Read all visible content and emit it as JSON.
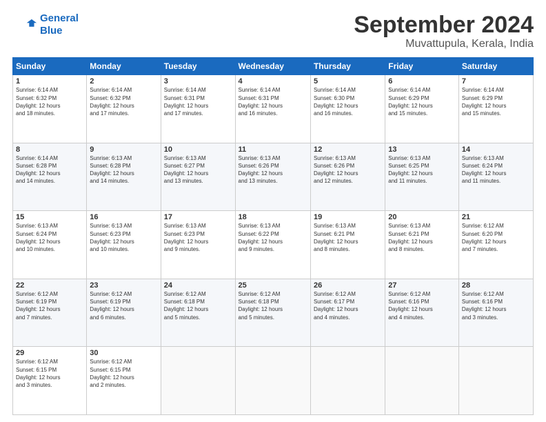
{
  "header": {
    "logo_line1": "General",
    "logo_line2": "Blue",
    "month": "September 2024",
    "location": "Muvattupula, Kerala, India"
  },
  "columns": [
    "Sunday",
    "Monday",
    "Tuesday",
    "Wednesday",
    "Thursday",
    "Friday",
    "Saturday"
  ],
  "weeks": [
    [
      {
        "day": "1",
        "info": "Sunrise: 6:14 AM\nSunset: 6:32 PM\nDaylight: 12 hours\nand 18 minutes."
      },
      {
        "day": "2",
        "info": "Sunrise: 6:14 AM\nSunset: 6:32 PM\nDaylight: 12 hours\nand 17 minutes."
      },
      {
        "day": "3",
        "info": "Sunrise: 6:14 AM\nSunset: 6:31 PM\nDaylight: 12 hours\nand 17 minutes."
      },
      {
        "day": "4",
        "info": "Sunrise: 6:14 AM\nSunset: 6:31 PM\nDaylight: 12 hours\nand 16 minutes."
      },
      {
        "day": "5",
        "info": "Sunrise: 6:14 AM\nSunset: 6:30 PM\nDaylight: 12 hours\nand 16 minutes."
      },
      {
        "day": "6",
        "info": "Sunrise: 6:14 AM\nSunset: 6:29 PM\nDaylight: 12 hours\nand 15 minutes."
      },
      {
        "day": "7",
        "info": "Sunrise: 6:14 AM\nSunset: 6:29 PM\nDaylight: 12 hours\nand 15 minutes."
      }
    ],
    [
      {
        "day": "8",
        "info": "Sunrise: 6:14 AM\nSunset: 6:28 PM\nDaylight: 12 hours\nand 14 minutes."
      },
      {
        "day": "9",
        "info": "Sunrise: 6:13 AM\nSunset: 6:28 PM\nDaylight: 12 hours\nand 14 minutes."
      },
      {
        "day": "10",
        "info": "Sunrise: 6:13 AM\nSunset: 6:27 PM\nDaylight: 12 hours\nand 13 minutes."
      },
      {
        "day": "11",
        "info": "Sunrise: 6:13 AM\nSunset: 6:26 PM\nDaylight: 12 hours\nand 13 minutes."
      },
      {
        "day": "12",
        "info": "Sunrise: 6:13 AM\nSunset: 6:26 PM\nDaylight: 12 hours\nand 12 minutes."
      },
      {
        "day": "13",
        "info": "Sunrise: 6:13 AM\nSunset: 6:25 PM\nDaylight: 12 hours\nand 11 minutes."
      },
      {
        "day": "14",
        "info": "Sunrise: 6:13 AM\nSunset: 6:24 PM\nDaylight: 12 hours\nand 11 minutes."
      }
    ],
    [
      {
        "day": "15",
        "info": "Sunrise: 6:13 AM\nSunset: 6:24 PM\nDaylight: 12 hours\nand 10 minutes."
      },
      {
        "day": "16",
        "info": "Sunrise: 6:13 AM\nSunset: 6:23 PM\nDaylight: 12 hours\nand 10 minutes."
      },
      {
        "day": "17",
        "info": "Sunrise: 6:13 AM\nSunset: 6:23 PM\nDaylight: 12 hours\nand 9 minutes."
      },
      {
        "day": "18",
        "info": "Sunrise: 6:13 AM\nSunset: 6:22 PM\nDaylight: 12 hours\nand 9 minutes."
      },
      {
        "day": "19",
        "info": "Sunrise: 6:13 AM\nSunset: 6:21 PM\nDaylight: 12 hours\nand 8 minutes."
      },
      {
        "day": "20",
        "info": "Sunrise: 6:13 AM\nSunset: 6:21 PM\nDaylight: 12 hours\nand 8 minutes."
      },
      {
        "day": "21",
        "info": "Sunrise: 6:12 AM\nSunset: 6:20 PM\nDaylight: 12 hours\nand 7 minutes."
      }
    ],
    [
      {
        "day": "22",
        "info": "Sunrise: 6:12 AM\nSunset: 6:19 PM\nDaylight: 12 hours\nand 7 minutes."
      },
      {
        "day": "23",
        "info": "Sunrise: 6:12 AM\nSunset: 6:19 PM\nDaylight: 12 hours\nand 6 minutes."
      },
      {
        "day": "24",
        "info": "Sunrise: 6:12 AM\nSunset: 6:18 PM\nDaylight: 12 hours\nand 5 minutes."
      },
      {
        "day": "25",
        "info": "Sunrise: 6:12 AM\nSunset: 6:18 PM\nDaylight: 12 hours\nand 5 minutes."
      },
      {
        "day": "26",
        "info": "Sunrise: 6:12 AM\nSunset: 6:17 PM\nDaylight: 12 hours\nand 4 minutes."
      },
      {
        "day": "27",
        "info": "Sunrise: 6:12 AM\nSunset: 6:16 PM\nDaylight: 12 hours\nand 4 minutes."
      },
      {
        "day": "28",
        "info": "Sunrise: 6:12 AM\nSunset: 6:16 PM\nDaylight: 12 hours\nand 3 minutes."
      }
    ],
    [
      {
        "day": "29",
        "info": "Sunrise: 6:12 AM\nSunset: 6:15 PM\nDaylight: 12 hours\nand 3 minutes."
      },
      {
        "day": "30",
        "info": "Sunrise: 6:12 AM\nSunset: 6:15 PM\nDaylight: 12 hours\nand 2 minutes."
      },
      {
        "day": "",
        "info": ""
      },
      {
        "day": "",
        "info": ""
      },
      {
        "day": "",
        "info": ""
      },
      {
        "day": "",
        "info": ""
      },
      {
        "day": "",
        "info": ""
      }
    ]
  ]
}
